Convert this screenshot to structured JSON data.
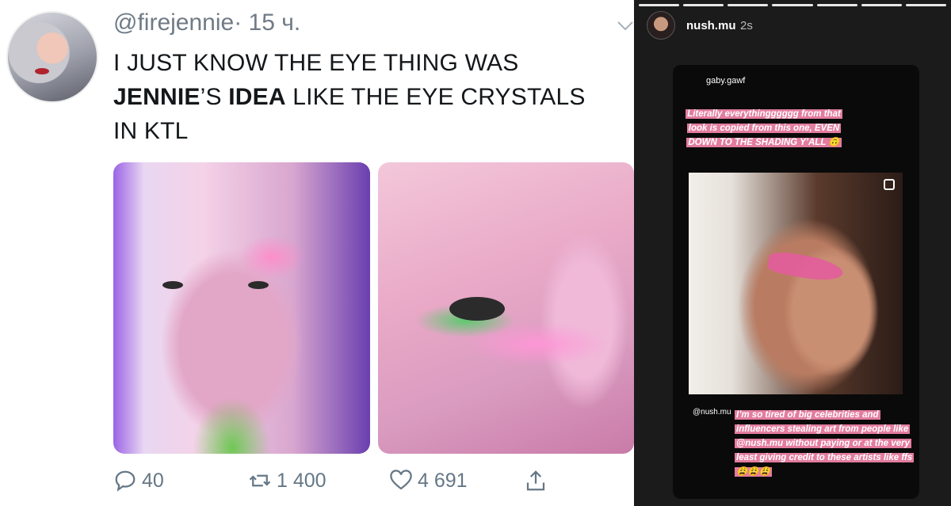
{
  "tweet": {
    "handle": "@firejennie",
    "separator": "·",
    "time": "15 ч.",
    "text_part1": "I JUST KNOW THE EYE THING WAS",
    "text_bold1": "JENNIE",
    "text_part2": "’S ",
    "text_bold2": "IDEA",
    "text_part3": " LIKE THE EYE CRYSTALS",
    "text_part4": "IN KTL",
    "actions": {
      "reply_count": "40",
      "retweet_count": "1 400",
      "like_count": "4 691"
    },
    "icons": [
      "reply-icon",
      "retweet-icon",
      "like-icon",
      "share-icon",
      "chevron-down-icon"
    ]
  },
  "story": {
    "username": "nush.mu",
    "time": "2s",
    "progress_segments": 7,
    "card": {
      "poster": "gaby.gawf",
      "quote1": "Literally everythingggggg from that look is copied from this one, EVEN DOWN TO THE SHADING Y’ALL 🙃",
      "mention": "@nush.mu",
      "quote2": "I’m so tired of big celebrities and influencers stealing art from people like @nush.mu without paying or at the very least giving credit to these artists like ffs 😩😩😩"
    }
  },
  "colors": {
    "tweet_text": "#14171a",
    "tweet_meta": "#657786",
    "story_bg": "#1b1b1b",
    "highlight": "#e37c9f"
  }
}
